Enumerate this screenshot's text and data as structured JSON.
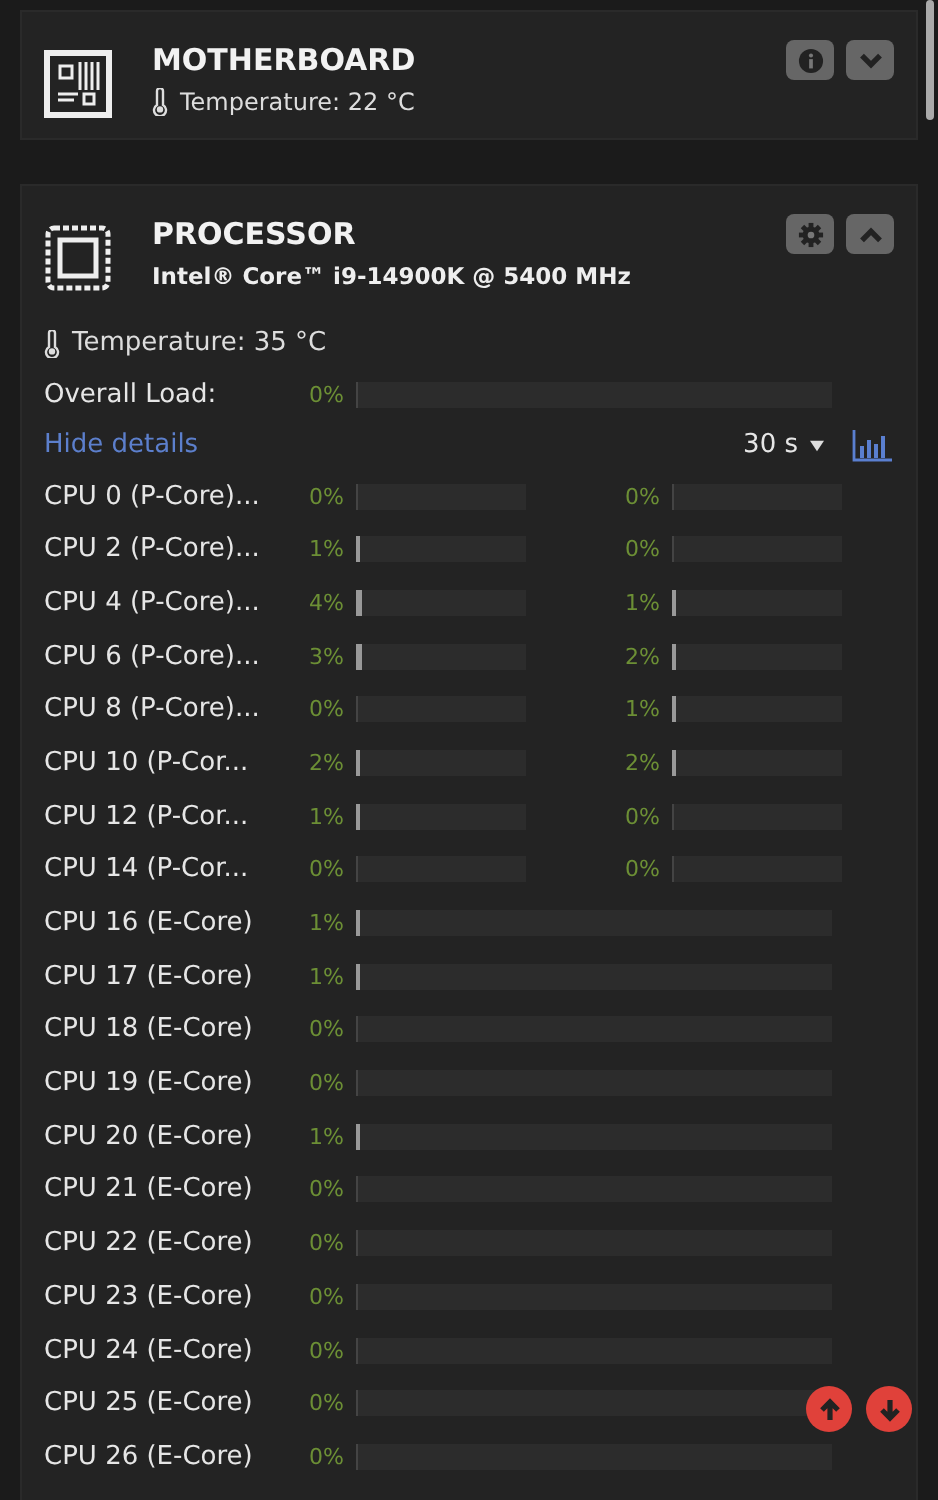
{
  "motherboard": {
    "title": "MOTHERBOARD",
    "temperature": "Temperature: 22 °C"
  },
  "processor": {
    "title": "PROCESSOR",
    "subtitle": "Intel® Core™ i9-14900K @ 5400 MHz",
    "temperature": "Temperature: 35 °C",
    "overall_load": {
      "label": "Overall Load:",
      "reading": "0%",
      "level": 0.0
    },
    "details_link": "Hide details",
    "interval": "30 s",
    "cores": [
      {
        "name": "CPU 0 (P-Core)...",
        "threads": [
          {
            "reading": "0%",
            "level": 0.0
          },
          {
            "reading": "0%",
            "level": 0.0
          }
        ]
      },
      {
        "name": "CPU 2 (P-Core)...",
        "threads": [
          {
            "reading": "1%",
            "level": 0.01
          },
          {
            "reading": "0%",
            "level": 0.0
          }
        ]
      },
      {
        "name": "CPU 4 (P-Core)...",
        "threads": [
          {
            "reading": "4%",
            "level": 0.04
          },
          {
            "reading": "1%",
            "level": 0.01
          }
        ]
      },
      {
        "name": "CPU 6 (P-Core)...",
        "threads": [
          {
            "reading": "3%",
            "level": 0.03
          },
          {
            "reading": "2%",
            "level": 0.02
          }
        ]
      },
      {
        "name": "CPU 8 (P-Core)...",
        "threads": [
          {
            "reading": "0%",
            "level": 0.0
          },
          {
            "reading": "1%",
            "level": 0.01
          }
        ]
      },
      {
        "name": "CPU 10 (P-Cor...",
        "threads": [
          {
            "reading": "2%",
            "level": 0.02
          },
          {
            "reading": "2%",
            "level": 0.02
          }
        ]
      },
      {
        "name": "CPU 12 (P-Cor...",
        "threads": [
          {
            "reading": "1%",
            "level": 0.01
          },
          {
            "reading": "0%",
            "level": 0.0
          }
        ]
      },
      {
        "name": "CPU 14 (P-Cor...",
        "threads": [
          {
            "reading": "0%",
            "level": 0.0
          },
          {
            "reading": "0%",
            "level": 0.0
          }
        ]
      },
      {
        "name": "CPU 16 (E-Core)",
        "threads": [
          {
            "reading": "1%",
            "level": 0.01
          }
        ]
      },
      {
        "name": "CPU 17 (E-Core)",
        "threads": [
          {
            "reading": "1%",
            "level": 0.01
          }
        ]
      },
      {
        "name": "CPU 18 (E-Core)",
        "threads": [
          {
            "reading": "0%",
            "level": 0.0
          }
        ]
      },
      {
        "name": "CPU 19 (E-Core)",
        "threads": [
          {
            "reading": "0%",
            "level": 0.0
          }
        ]
      },
      {
        "name": "CPU 20 (E-Core)",
        "threads": [
          {
            "reading": "1%",
            "level": 0.01
          }
        ]
      },
      {
        "name": "CPU 21 (E-Core)",
        "threads": [
          {
            "reading": "0%",
            "level": 0.0
          }
        ]
      },
      {
        "name": "CPU 22 (E-Core)",
        "threads": [
          {
            "reading": "0%",
            "level": 0.0
          }
        ]
      },
      {
        "name": "CPU 23 (E-Core)",
        "threads": [
          {
            "reading": "0%",
            "level": 0.0
          }
        ]
      },
      {
        "name": "CPU 24 (E-Core)",
        "threads": [
          {
            "reading": "0%",
            "level": 0.0
          }
        ]
      },
      {
        "name": "CPU 25 (E-Core)",
        "threads": [
          {
            "reading": "0%",
            "level": 0.0
          }
        ]
      },
      {
        "name": "CPU 26 (E-Core)",
        "threads": [
          {
            "reading": "0%",
            "level": 0.0
          }
        ]
      }
    ]
  }
}
